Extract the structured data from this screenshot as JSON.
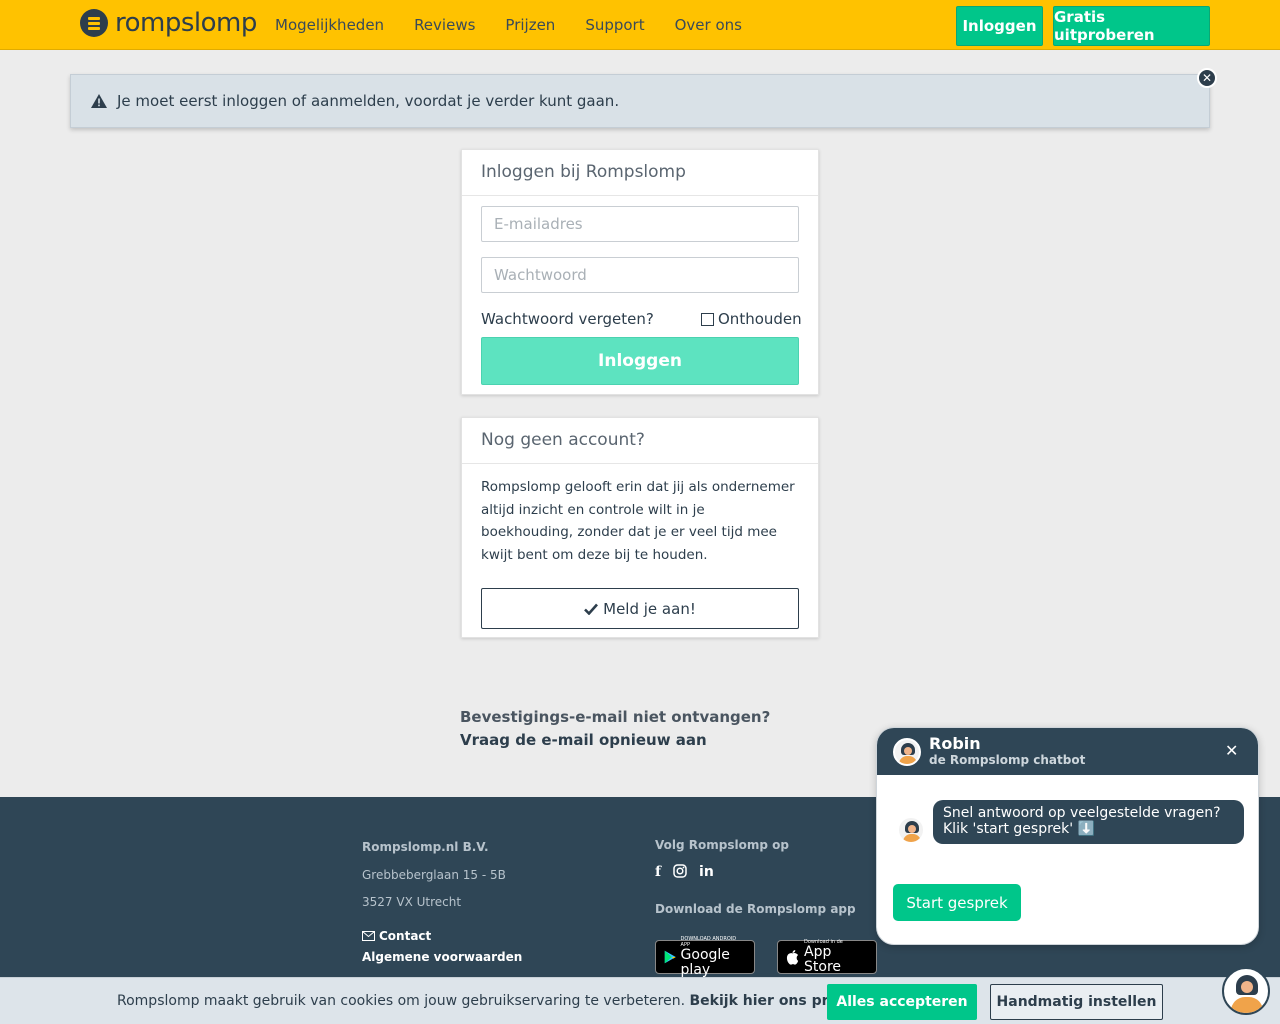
{
  "header": {
    "brand": "rompslomp",
    "nav": [
      "Mogelijkheden",
      "Reviews",
      "Prijzen",
      "Support",
      "Over ons"
    ],
    "login_label": "Inloggen",
    "trial_label": "Gratis uitproberen"
  },
  "alert": {
    "message": "Je moet eerst inloggen of aanmelden, voordat je verder kunt gaan.",
    "close": "✕"
  },
  "login": {
    "title": "Inloggen bij Rompslomp",
    "email_placeholder": "E-mailadres",
    "password_placeholder": "Wachtwoord",
    "forgot": "Wachtwoord vergeten?",
    "remember": "Onthouden",
    "submit": "Inloggen"
  },
  "signup": {
    "title": "Nog geen account?",
    "body": "Rompslomp gelooft erin dat jij als ondernemer altijd inzicht en controle wilt in je boekhouding, zonder dat je er veel tijd mee kwijt bent om deze bij te houden.",
    "button": "Meld je aan!"
  },
  "resend": {
    "question": "Bevestigings-e-mail niet ontvangen?",
    "link": "Vraag de e-mail opnieuw aan"
  },
  "footer": {
    "company": "Rompslomp.nl B.V.",
    "street": "Grebbeberglaan 15 - 5B",
    "city": "3527 VX Utrecht",
    "contact": "Contact",
    "terms": "Algemene voorwaarden",
    "follow": "Volg Rompslomp op",
    "download": "Download de Rompslomp app",
    "google_small": "DOWNLOAD ANDROID APP",
    "google_big": "Google play",
    "apple_small": "Download in de",
    "apple_big": "App Store"
  },
  "chat": {
    "name": "Robin",
    "subtitle": "de Rompslomp chatbot",
    "message": "Snel antwoord op veelgestelde vragen? Klik 'start gesprek' ⬇️",
    "start": "Start gesprek"
  },
  "cookie": {
    "text": "Rompslomp maakt gebruik van cookies om jouw gebruikservaring te verbeteren.",
    "link": "Bekijk hier ons privacybeleid.",
    "accept": "Alles accepteren",
    "manual": "Handmatig instellen"
  },
  "colors": {
    "header": "#ffc200",
    "accent": "#00c68a",
    "dark": "#2f4656"
  }
}
